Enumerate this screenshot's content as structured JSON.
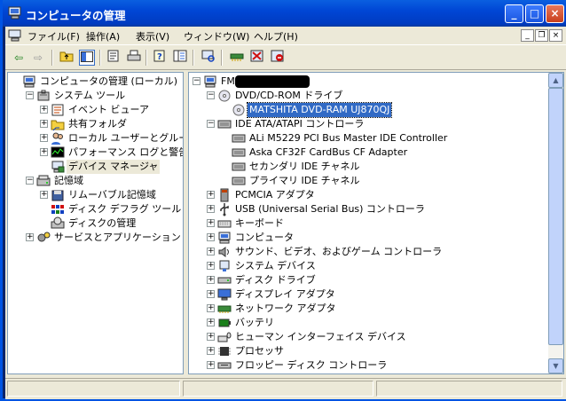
{
  "window": {
    "title": "コンピュータの管理",
    "minimize": "_",
    "maximize": "□",
    "close": "×"
  },
  "menu": [
    "ファイル(F)",
    "操作(A)",
    "表示(V)",
    "ウィンドウ(W)",
    "ヘルプ(H)"
  ],
  "left_tree": [
    {
      "label": "コンピュータの管理 (ローカル)",
      "icon": "computer-icon",
      "level": 0,
      "exp": ""
    },
    {
      "label": "システム ツール",
      "icon": "tools-icon",
      "level": 1,
      "exp": "-"
    },
    {
      "label": "イベント ビューア",
      "icon": "event-viewer-icon",
      "level": 2,
      "exp": "+"
    },
    {
      "label": "共有フォルダ",
      "icon": "shared-folder-icon",
      "level": 2,
      "exp": "+"
    },
    {
      "label": "ローカル ユーザーとグループ",
      "icon": "users-icon",
      "level": 2,
      "exp": "+"
    },
    {
      "label": "パフォーマンス ログと警告",
      "icon": "performance-icon",
      "level": 2,
      "exp": "+"
    },
    {
      "label": "デバイス マネージャ",
      "icon": "device-manager-icon",
      "level": 2,
      "exp": "",
      "hl": true
    },
    {
      "label": "記憶域",
      "icon": "storage-icon",
      "level": 1,
      "exp": "-"
    },
    {
      "label": "リムーバブル記憶域",
      "icon": "removable-storage-icon",
      "level": 2,
      "exp": "+"
    },
    {
      "label": "ディスク デフラグ ツール",
      "icon": "defrag-icon",
      "level": 2,
      "exp": ""
    },
    {
      "label": "ディスクの管理",
      "icon": "disk-management-icon",
      "level": 2,
      "exp": ""
    },
    {
      "label": "サービスとアプリケーション",
      "icon": "services-icon",
      "level": 1,
      "exp": "+"
    }
  ],
  "right_tree": [
    {
      "label": "FM",
      "icon": "computer-icon",
      "level": 0,
      "exp": "-",
      "redacted": true
    },
    {
      "label": "DVD/CD-ROM ドライブ",
      "icon": "cdrom-icon",
      "level": 1,
      "exp": "-"
    },
    {
      "label": "MATSHITA DVD-RAM UJ870QJ",
      "icon": "cdrom-icon",
      "level": 2,
      "exp": "",
      "sel": true
    },
    {
      "label": "IDE ATA/ATAPI コントローラ",
      "icon": "ide-icon",
      "level": 1,
      "exp": "-"
    },
    {
      "label": "ALi M5229 PCI Bus Master IDE Controller",
      "icon": "ide-icon",
      "level": 2,
      "exp": ""
    },
    {
      "label": "Aska CF32F CardBus CF Adapter",
      "icon": "ide-icon",
      "level": 2,
      "exp": ""
    },
    {
      "label": "セカンダリ IDE チャネル",
      "icon": "ide-icon",
      "level": 2,
      "exp": ""
    },
    {
      "label": "プライマリ IDE チャネル",
      "icon": "ide-icon",
      "level": 2,
      "exp": ""
    },
    {
      "label": "PCMCIA アダプタ",
      "icon": "pcmcia-icon",
      "level": 1,
      "exp": "+"
    },
    {
      "label": "USB (Universal Serial Bus) コントローラ",
      "icon": "usb-icon",
      "level": 1,
      "exp": "+"
    },
    {
      "label": "キーボード",
      "icon": "keyboard-icon",
      "level": 1,
      "exp": "+"
    },
    {
      "label": "コンピュータ",
      "icon": "computer-icon",
      "level": 1,
      "exp": "+"
    },
    {
      "label": "サウンド、ビデオ、およびゲーム コントローラ",
      "icon": "sound-icon",
      "level": 1,
      "exp": "+"
    },
    {
      "label": "システム デバイス",
      "icon": "system-device-icon",
      "level": 1,
      "exp": "+"
    },
    {
      "label": "ディスク ドライブ",
      "icon": "disk-drive-icon",
      "level": 1,
      "exp": "+"
    },
    {
      "label": "ディスプレイ アダプタ",
      "icon": "display-icon",
      "level": 1,
      "exp": "+"
    },
    {
      "label": "ネットワーク アダプタ",
      "icon": "network-icon",
      "level": 1,
      "exp": "+"
    },
    {
      "label": "バッテリ",
      "icon": "battery-icon",
      "level": 1,
      "exp": "+"
    },
    {
      "label": "ヒューマン インターフェイス デバイス",
      "icon": "hid-icon",
      "level": 1,
      "exp": "+"
    },
    {
      "label": "プロセッサ",
      "icon": "processor-icon",
      "level": 1,
      "exp": "+"
    },
    {
      "label": "フロッピー ディスク コントローラ",
      "icon": "floppy-icon",
      "level": 1,
      "exp": "+"
    }
  ],
  "colors": {
    "titlebar": "#0054e3",
    "selection": "#316ac5",
    "face": "#ece9d8"
  }
}
